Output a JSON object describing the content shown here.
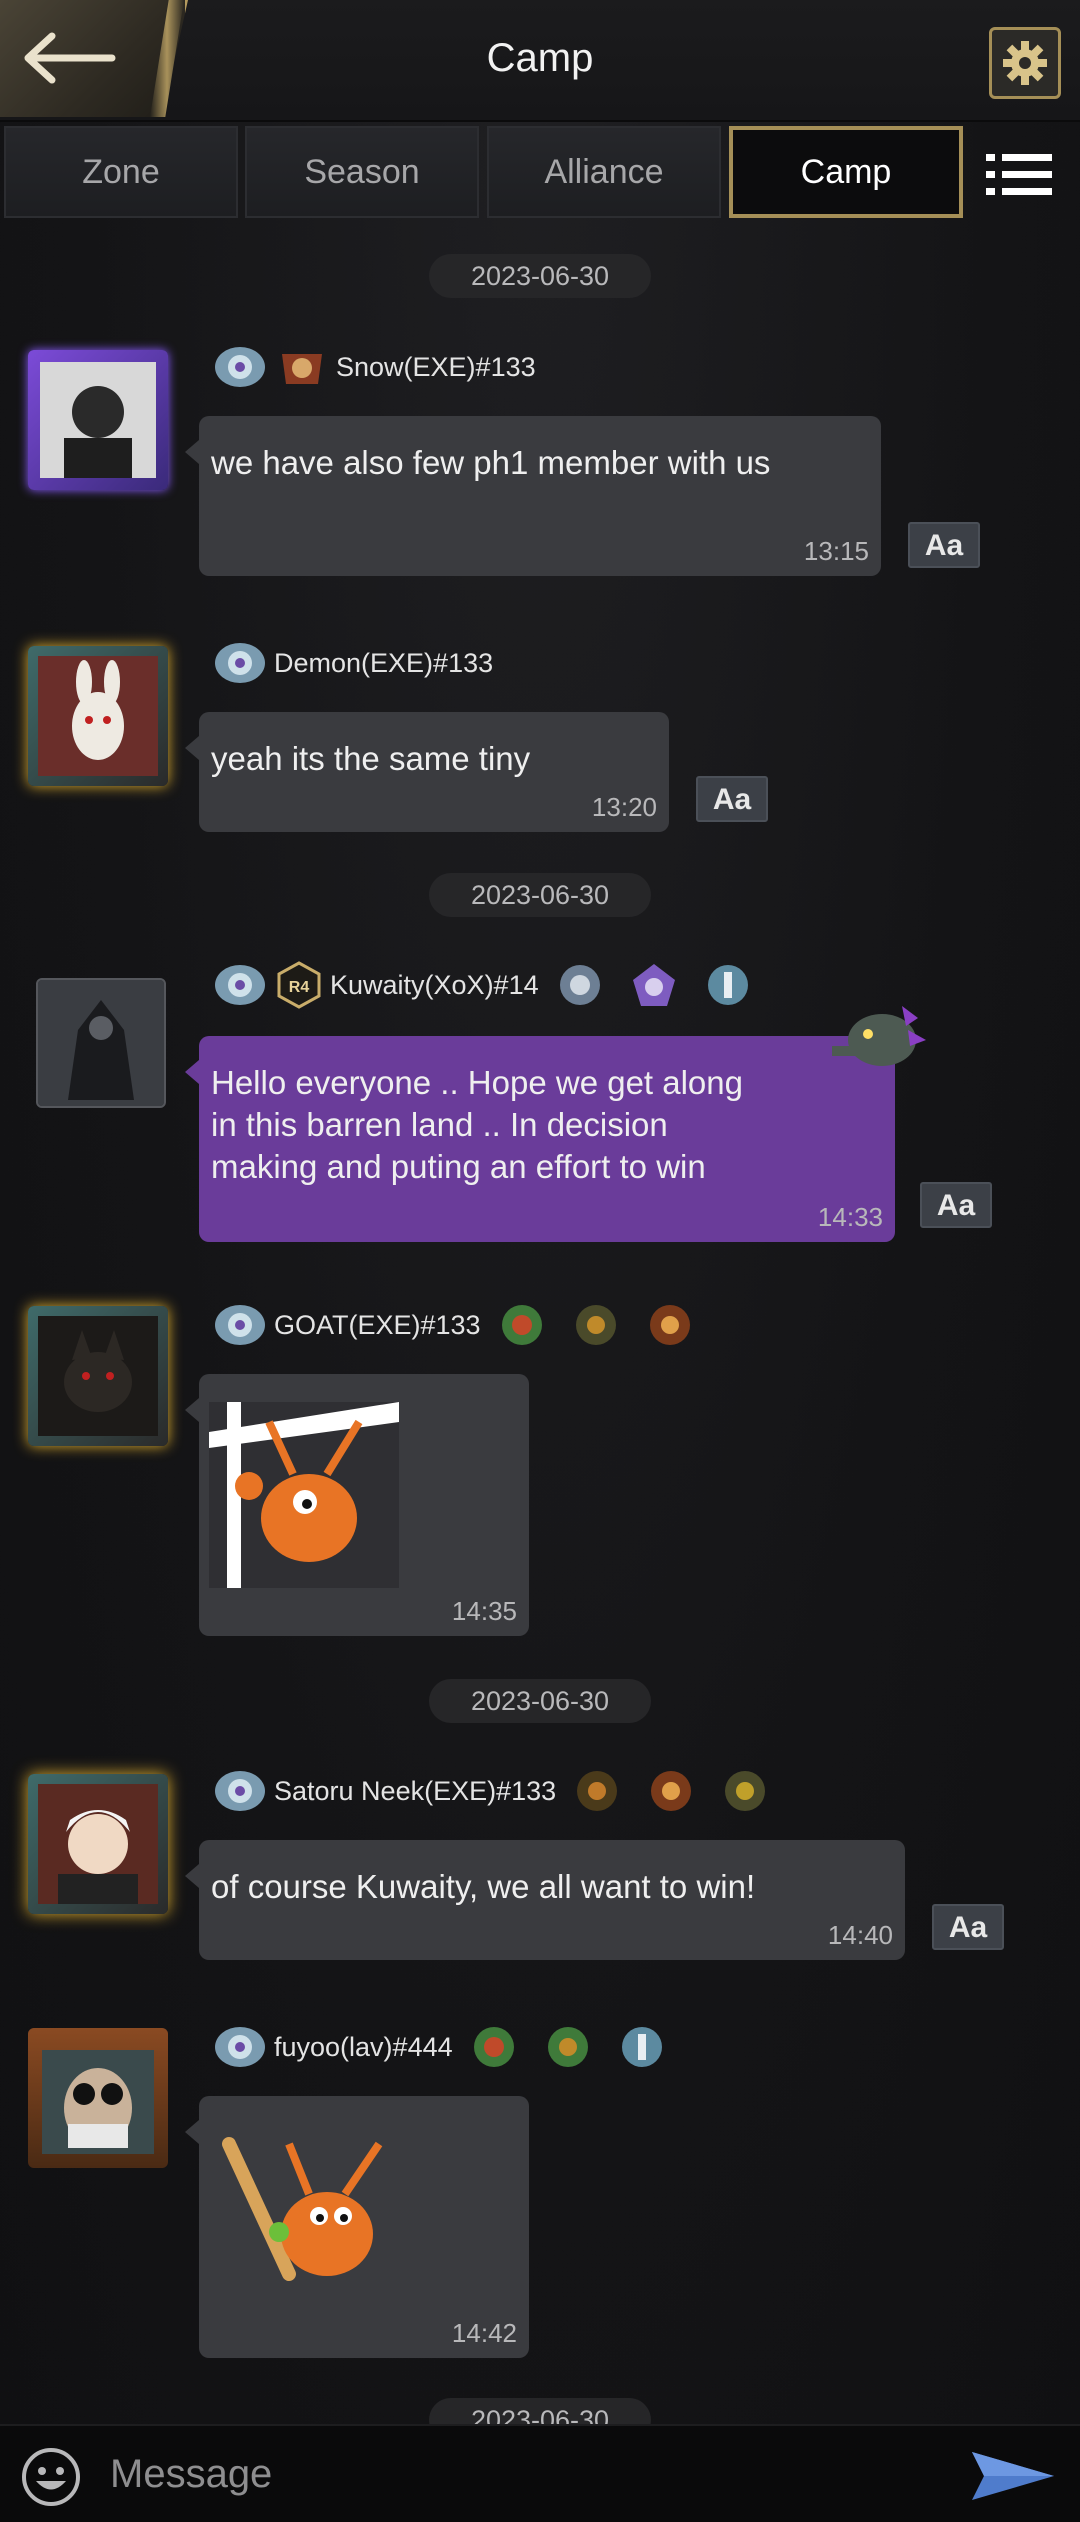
{
  "header": {
    "title": "Camp",
    "back_icon": "back-arrow-icon",
    "settings_icon": "gear-icon"
  },
  "tabs": [
    {
      "label": "Zone",
      "active": false
    },
    {
      "label": "Season",
      "active": false
    },
    {
      "label": "Alliance",
      "active": false
    },
    {
      "label": "Camp",
      "active": true
    }
  ],
  "menu_icon": "list-menu-icon",
  "dates": [
    "2023-06-30",
    "2023-06-30",
    "2023-06-30",
    "2023-06-30"
  ],
  "messages": [
    {
      "user": "Snow(EXE)#133",
      "text": "we have also few ph1 member with us",
      "time": "13:15"
    },
    {
      "user": "Demon(EXE)#133",
      "text": "yeah its the same tiny",
      "time": "13:20"
    },
    {
      "user": "Kuwaity(XoX)#14",
      "rank": "R4",
      "text": "Hello  everyone .. Hope we get along in this barren land .. In decision making and puting an effort to win",
      "time": "14:33"
    },
    {
      "user": "GOAT(EXE)#133",
      "sticker": "ant-sticker",
      "time": "14:35"
    },
    {
      "user": "Satoru Neek(EXE)#133",
      "text": "of course Kuwaity, we all want to win!",
      "time": "14:40"
    },
    {
      "user": "fuyoo(lav)#444",
      "sticker": "ant-bat-sticker",
      "time": "14:42"
    }
  ],
  "translate": {
    "big": "A",
    "small": "a"
  },
  "input": {
    "placeholder": "Message"
  },
  "colors": {
    "accent_gold": "#a58f57",
    "bubble": "#3a3b3f",
    "bubble_own": "#6a3c9a",
    "background": "#141416"
  }
}
